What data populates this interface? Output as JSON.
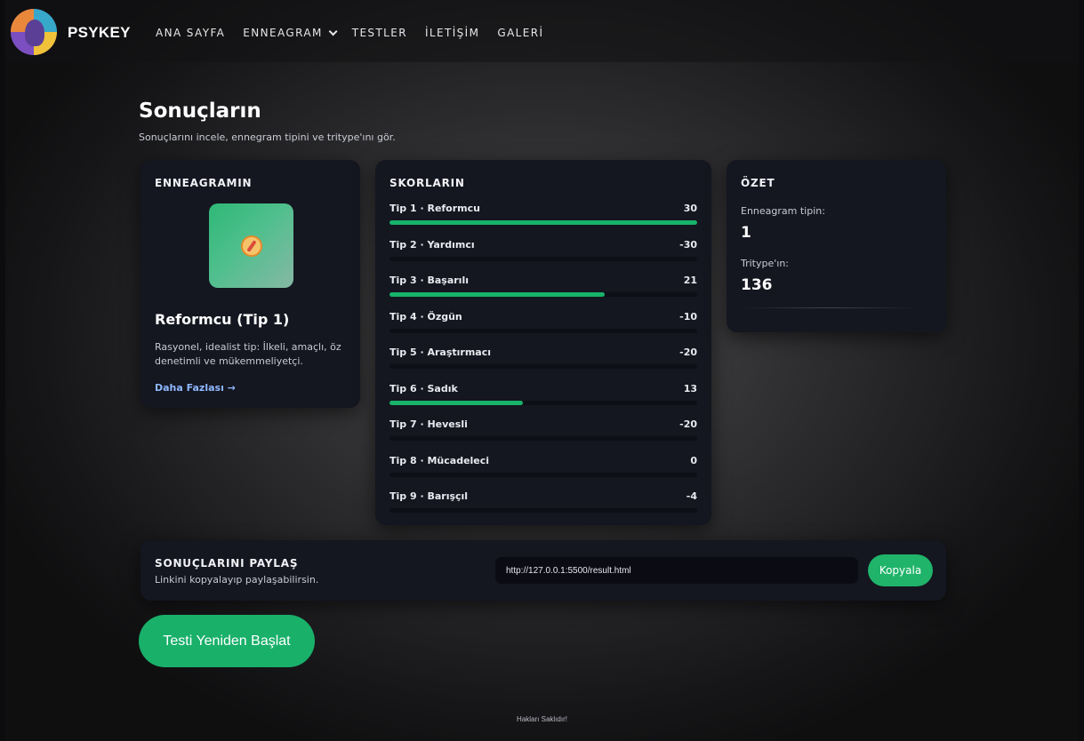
{
  "nav": {
    "brand": "PSYKEY",
    "links": [
      "ANA SAYFA",
      "ENNEAGRAM",
      "TESTLER",
      "İLETİŞİM",
      "GALERİ"
    ]
  },
  "page": {
    "title": "Sonuçların",
    "subtitle": "Sonuçlarını incele, ennegram tipini ve tritype'ını gör."
  },
  "enneagram": {
    "heading": "ENNEAGRAMIN",
    "icon": "compass-icon",
    "name": "Reformcu (Tip 1)",
    "description": "Rasyonel, idealist tip: İlkeli, amaçlı, öz denetimli ve mükemmeliyetçi.",
    "link": "Daha Fazlası →"
  },
  "scores": {
    "heading": "SKORLARIN",
    "max": 30,
    "items": [
      {
        "label": "Tip 1 · Reformcu",
        "value": 30
      },
      {
        "label": "Tip 2 · Yardımcı",
        "value": -30
      },
      {
        "label": "Tip 3 · Başarılı",
        "value": 21
      },
      {
        "label": "Tip 4 · Özgün",
        "value": -10
      },
      {
        "label": "Tip 5 · Araştırmacı",
        "value": -20
      },
      {
        "label": "Tip 6 · Sadık",
        "value": 13
      },
      {
        "label": "Tip 7 · Hevesli",
        "value": -20
      },
      {
        "label": "Tip 8 · Mücadeleci",
        "value": 0
      },
      {
        "label": "Tip 9 · Barışçıl",
        "value": -4
      }
    ]
  },
  "summary": {
    "heading": "ÖZET",
    "type_label": "Enneagram tipin:",
    "type_value": "1",
    "tritype_label": "Tritype'ın:",
    "tritype_value": "136"
  },
  "share": {
    "title": "SONUÇLARINI PAYLAŞ",
    "subtitle": "Linkini kopyalayıp paylaşabilirsin.",
    "url": "http://127.0.0.1:5500/result.html",
    "copy_label": "Kopyala"
  },
  "restart_label": "Testi Yeniden Başlat",
  "footer": "Hakları Saklıdır!",
  "colors": {
    "accent": "#19b06a",
    "card": "#141620",
    "link": "#8fb8ff"
  }
}
